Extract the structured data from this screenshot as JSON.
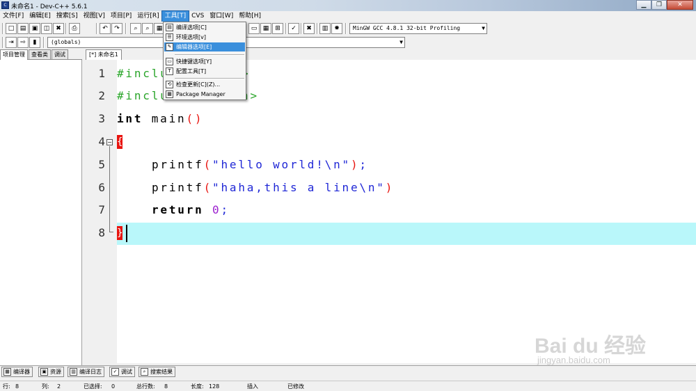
{
  "window": {
    "title": "未命名1 - Dev-C++ 5.6.1",
    "controls": [
      "minimize-icon",
      "maximize-icon",
      "close-icon"
    ]
  },
  "menubar": {
    "items": [
      "文件[F]",
      "编辑[E]",
      "搜索[S]",
      "视图[V]",
      "项目[P]",
      "运行[R]",
      "工具[T]",
      "CVS",
      "窗口[W]",
      "帮助[H]"
    ],
    "active": "工具[T]"
  },
  "toolbar": {
    "compiler_select": "MinGW GCC 4.8.1 32-bit Profiling",
    "scope_select": "(globals)"
  },
  "tools_menu": {
    "items": [
      {
        "label": "编译选项[C]",
        "icon": "compiler-options-icon"
      },
      {
        "label": "环境选项[v]",
        "icon": "environment-options-icon"
      },
      {
        "label": "编辑器选项[E]",
        "icon": "editor-options-icon",
        "highlighted": true
      },
      {
        "label": "快捷键选项[Y]",
        "icon": "shortcut-options-icon"
      },
      {
        "label": "配置工具[T]",
        "icon": "configure-tools-icon"
      },
      {
        "label": "检查更新[C](Z)...",
        "icon": "check-update-icon"
      },
      {
        "label": "Package Manager",
        "icon": "package-manager-icon"
      }
    ]
  },
  "left_panel": {
    "tabs": [
      "项目管理",
      "查看类",
      "调试"
    ],
    "active_tab": "项目管理"
  },
  "editor": {
    "tab_label": "[*] 未命名1",
    "current_line": 8,
    "lines": [
      {
        "n": "1",
        "code": "#include <stdio.h>",
        "visible_prefix": "#inclu",
        "visible_suffix": "h>"
      },
      {
        "n": "2",
        "code": "#include <stdlib.h>",
        "visible_prefix": "#inclu",
        "visible_suffix": ".h>"
      },
      {
        "n": "3",
        "kw": "int",
        "id": "main",
        "par": "()"
      },
      {
        "n": "4",
        "brace": "{"
      },
      {
        "n": "5",
        "id": "printf",
        "open": "(",
        "str": "\"hello world!\\n\"",
        "close": ")",
        "semi": ";"
      },
      {
        "n": "6",
        "id": "printf",
        "open": "(",
        "str": "\"haha,this a line\\n\"",
        "close": ")"
      },
      {
        "n": "7",
        "kw": "return",
        "num": "0",
        "semi": ";"
      },
      {
        "n": "8",
        "brace": "}"
      }
    ]
  },
  "bottom_tabs": [
    {
      "label": "编译器",
      "icon": "compiler-icon"
    },
    {
      "label": "资源",
      "icon": "resources-icon"
    },
    {
      "label": "编译日志",
      "icon": "compile-log-icon"
    },
    {
      "label": "调试",
      "icon": "debug-icon"
    },
    {
      "label": "搜索结果",
      "icon": "search-results-icon"
    }
  ],
  "statusbar": {
    "row_label": "行:",
    "row": "8",
    "col_label": "列:",
    "col": "2",
    "selected_label": "已选择:",
    "selected": "0",
    "total_label": "总行数:",
    "total": "8",
    "length_label": "长度:",
    "length": "128",
    "mode": "插入",
    "modified": "已修改"
  },
  "watermark": {
    "brand": "Bai du 经验",
    "url": "jingyan.baidu.com"
  },
  "colors": {
    "menu_highlight": "#3a8fdc",
    "current_line_bg": "#b9f7fa",
    "brace_match": "#e8140f",
    "preprocessor": "#2aa52a",
    "string": "#1f27d6",
    "number": "#9b1fcf"
  }
}
